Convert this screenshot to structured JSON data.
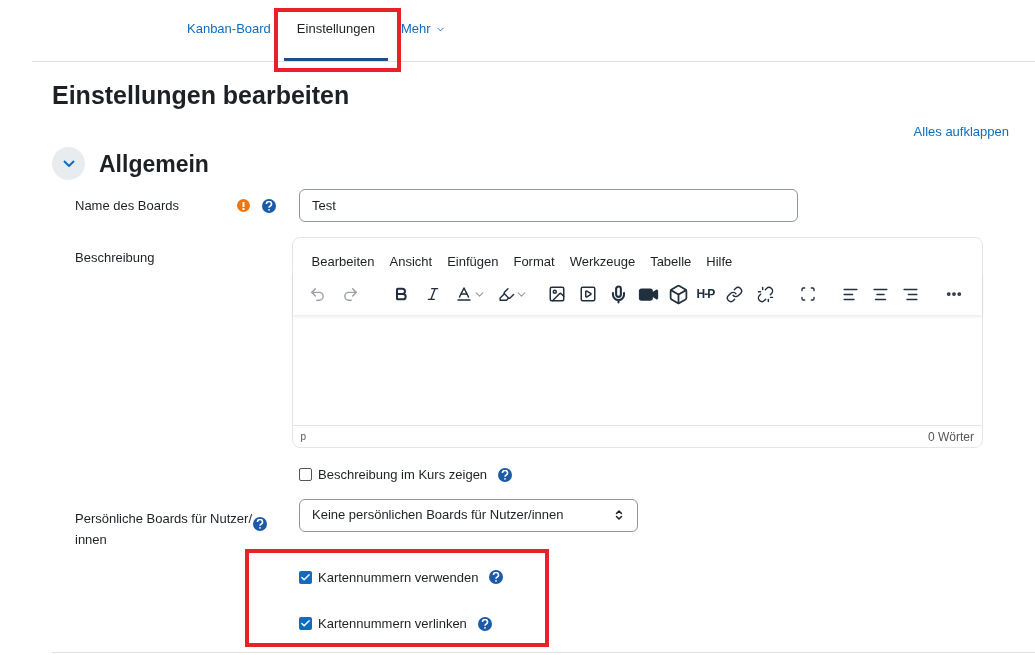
{
  "nav": {
    "tabs": [
      {
        "label": "Kanban-Board",
        "selected": false
      },
      {
        "label": "Einstellungen",
        "selected": true
      },
      {
        "label": "Mehr",
        "selected": false
      }
    ]
  },
  "page_title": "Einstellungen bearbeiten",
  "expand_all": "Alles aufklappen",
  "section": {
    "title": "Allgemein",
    "expanded": true
  },
  "name_field": {
    "label": "Name des Boards",
    "required": true,
    "value": "Test"
  },
  "description": {
    "label": "Beschreibung",
    "menu": [
      "Bearbeiten",
      "Ansicht",
      "Einfügen",
      "Format",
      "Werkzeuge",
      "Tabelle",
      "Hilfe"
    ],
    "undo": {
      "disabled": true
    },
    "redo": {
      "disabled": true
    },
    "h5p_label": "H-P",
    "path": "p",
    "word_count": "0 Wörter"
  },
  "show_in_course": {
    "label": "Beschreibung im Kurs zeigen",
    "checked": false
  },
  "personal_boards": {
    "label": "Persönliche Boards für Nutzer/ innen",
    "value": "Keine persönlichen Boards für Nutzer/innen"
  },
  "card_options": [
    {
      "label": "Kartennummern verwenden",
      "checked": true
    },
    {
      "label": "Kartennummern verlinken",
      "checked": true
    }
  ]
}
